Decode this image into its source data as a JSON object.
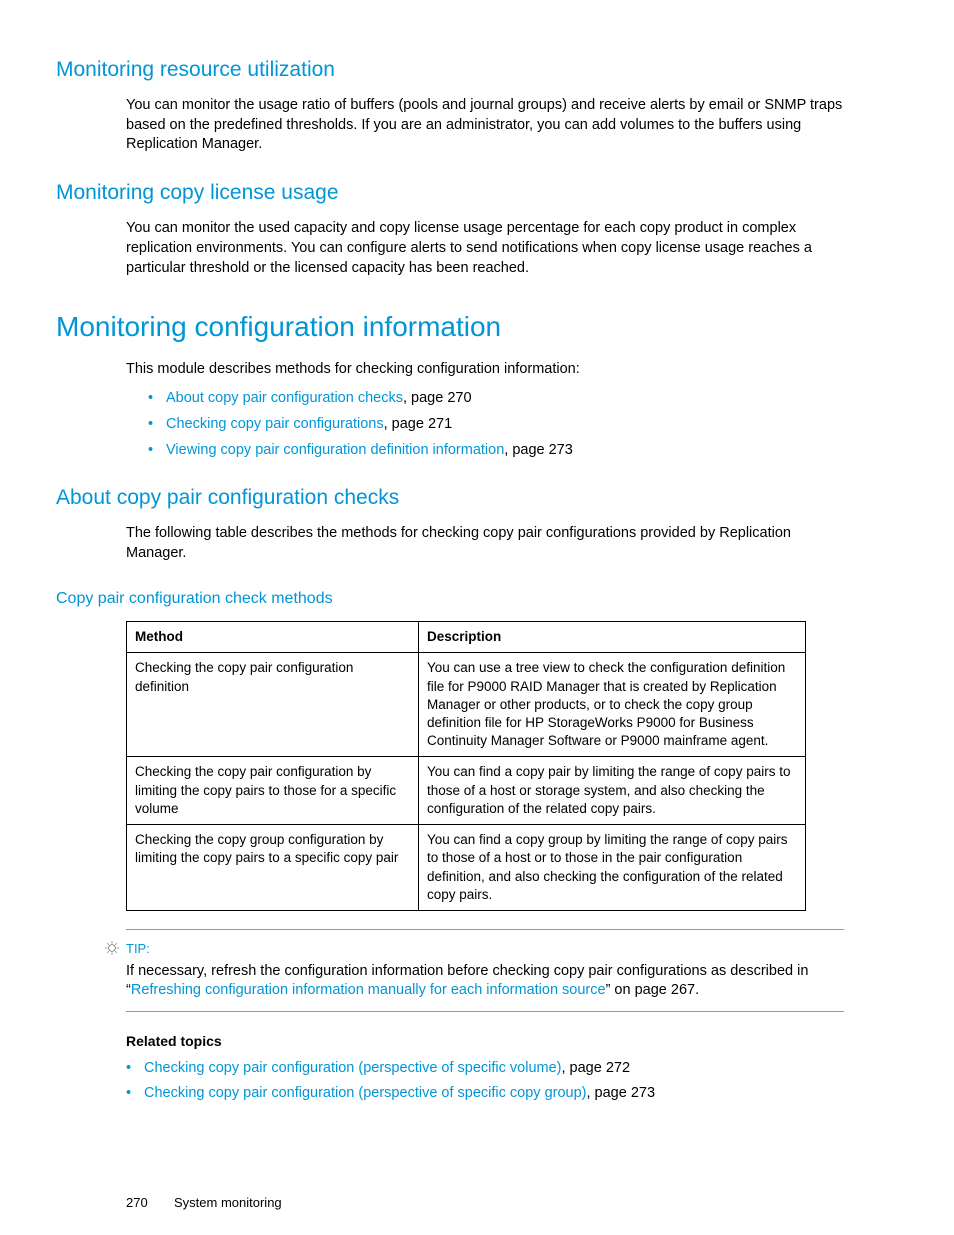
{
  "sections": {
    "resUtil": {
      "heading": "Monitoring resource utilization",
      "body": "You can monitor the usage ratio of buffers (pools and journal groups) and receive alerts by email or SNMP traps based on the predefined thresholds. If you are an administrator, you can add volumes to the buffers using Replication Manager."
    },
    "license": {
      "heading": "Monitoring copy license usage",
      "body": "You can monitor the used capacity and copy license usage percentage for each copy product in complex replication environments. You can configure alerts to send notifications when copy license usage reaches a particular threshold or the licensed capacity has been reached."
    },
    "configInfo": {
      "heading": "Monitoring configuration information",
      "intro": "This module describes methods for checking configuration information:",
      "links": [
        {
          "text": "About copy pair configuration checks",
          "suffix": ", page 270"
        },
        {
          "text": "Checking copy pair configurations",
          "suffix": ", page 271"
        },
        {
          "text": "Viewing copy pair configuration definition information",
          "suffix": ", page 273"
        }
      ]
    },
    "aboutChecks": {
      "heading": "About copy pair configuration checks",
      "body": "The following table describes the methods for checking copy pair configurations provided by Replication Manager."
    },
    "methodsHeading": "Copy pair configuration check methods"
  },
  "table": {
    "headers": [
      "Method",
      "Description"
    ],
    "rows": [
      {
        "method": "Checking the copy pair configuration definition",
        "desc": "You can use a tree view to check the configuration definition file for P9000 RAID Manager that is created by Replication Manager or other products, or to check the copy group definition file for HP StorageWorks P9000 for Business Continuity Manager Software or P9000 mainframe agent."
      },
      {
        "method": "Checking the copy pair configuration by limiting the copy pairs to those for a specific volume",
        "desc": "You can find a copy pair by limiting the range of copy pairs to those of a host or storage system, and also checking the configuration of the related copy pairs."
      },
      {
        "method": "Checking the copy group configuration by limiting the copy pairs to a specific copy pair",
        "desc": "You can find a copy group by limiting the range of copy pairs to those of a host or to those in the pair configuration definition, and also checking the configuration of the related copy pairs."
      }
    ]
  },
  "tip": {
    "label": "TIP:",
    "pre": "If necessary, refresh the configuration information before checking copy pair configurations as described in “",
    "link": "Refreshing configuration information manually for each information source",
    "post": "” on page 267."
  },
  "related": {
    "heading": "Related topics",
    "items": [
      {
        "text": "Checking copy pair configuration (perspective of specific volume)",
        "suffix": ", page 272"
      },
      {
        "text": "Checking copy pair configuration (perspective of specific copy group)",
        "suffix": ", page 273"
      }
    ]
  },
  "footer": {
    "page": "270",
    "label": "System monitoring"
  }
}
